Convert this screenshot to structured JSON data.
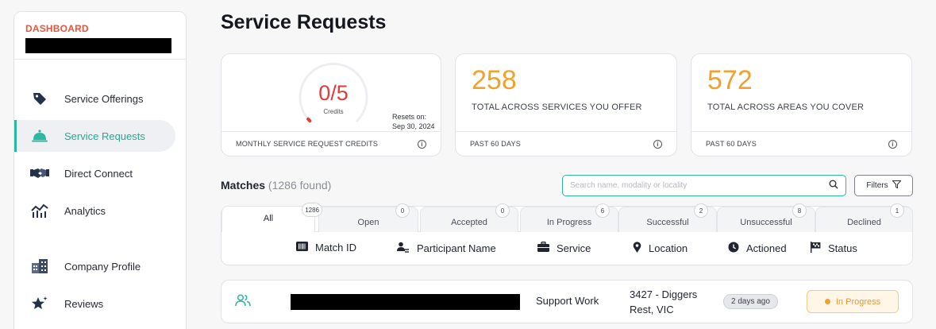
{
  "sidebar": {
    "brand_title": "DASHBOARD",
    "items": [
      {
        "label": "Service Offerings",
        "icon": "tag-icon"
      },
      {
        "label": "Service Requests",
        "icon": "bell-icon"
      },
      {
        "label": "Direct Connect",
        "icon": "handshake-icon"
      },
      {
        "label": "Analytics",
        "icon": "chart-line-icon"
      },
      {
        "label": "Company Profile",
        "icon": "building-icon"
      },
      {
        "label": "Reviews",
        "icon": "star-icon"
      }
    ]
  },
  "page": {
    "title": "Service Requests"
  },
  "cards": {
    "credits": {
      "value": "0/5",
      "sublabel": "Credits",
      "resets_label": "Resets on:",
      "resets_date": "Sep 30, 2024",
      "footer": "MONTHLY SERVICE REQUEST CREDITS",
      "used_fraction": 0
    },
    "services": {
      "value": "258",
      "label": "TOTAL ACROSS SERVICES YOU OFFER",
      "footer": "PAST 60 DAYS"
    },
    "areas": {
      "value": "572",
      "label": "TOTAL ACROSS AREAS YOU COVER",
      "footer": "PAST 60 DAYS"
    }
  },
  "matches": {
    "title": "Matches",
    "count": "(1286 found)",
    "search_placeholder": "Search name, modality or locality",
    "filters_label": "Filters"
  },
  "tabs": [
    {
      "label": "All",
      "count": "1286"
    },
    {
      "label": "Open",
      "count": "0"
    },
    {
      "label": "Accepted",
      "count": "0"
    },
    {
      "label": "In Progress",
      "count": "6"
    },
    {
      "label": "Successful",
      "count": "2"
    },
    {
      "label": "Unsuccessful",
      "count": "8"
    },
    {
      "label": "Declined",
      "count": "1"
    }
  ],
  "columns": [
    {
      "label": "Match ID",
      "icon": "barcode-icon"
    },
    {
      "label": "Participant Name",
      "icon": "person-icon"
    },
    {
      "label": "Service",
      "icon": "briefcase-icon"
    },
    {
      "label": "Location",
      "icon": "map-pin-icon"
    },
    {
      "label": "Actioned",
      "icon": "clock-icon"
    },
    {
      "label": "Status",
      "icon": "flag-icon"
    }
  ],
  "rows": [
    {
      "service": "Support Work",
      "location": "3427 - Diggers Rest, VIC",
      "actioned": "2 days ago",
      "status": "In Progress"
    }
  ],
  "colors": {
    "accent": "#2bb7a2",
    "brand": "#e8553b",
    "stat": "#f0a22e",
    "credits": "#e33b3b"
  }
}
